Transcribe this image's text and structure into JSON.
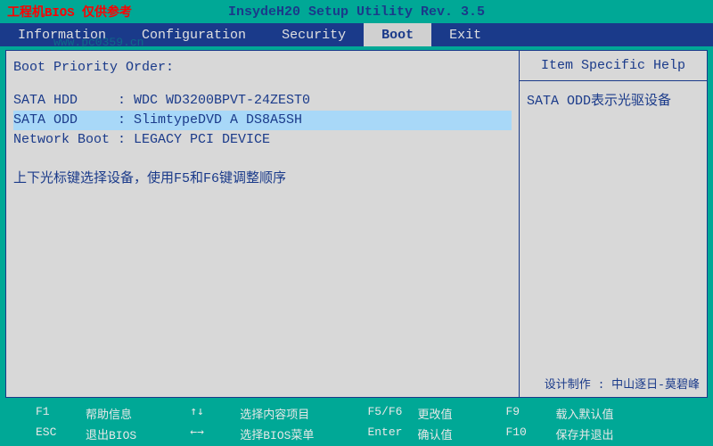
{
  "top": {
    "warning": "工程机BIOS  仅供参考",
    "title": "InsydeH20 Setup Utility Rev. 3.5"
  },
  "watermark": {
    "brand": "",
    "url": "www.pc0359.cn"
  },
  "tabs": {
    "items": [
      {
        "label": "Information"
      },
      {
        "label": "Configuration"
      },
      {
        "label": "Security"
      },
      {
        "label": "Boot"
      },
      {
        "label": "Exit"
      }
    ]
  },
  "main": {
    "header": "Boot Priority Order:",
    "rows": [
      {
        "key": "SATA HDD    ",
        "sep": " : ",
        "val": "WDC WD3200BPVT-24ZEST0",
        "selected": false
      },
      {
        "key": "SATA ODD    ",
        "sep": " : ",
        "val": "SlimtypeDVD A DS8A5SH",
        "selected": true
      },
      {
        "key": "Network Boot",
        "sep": " : ",
        "val": "LEGACY PCI DEVICE",
        "selected": false
      }
    ],
    "hint": "上下光标键选择设备，使用F5和F6键调整顺序"
  },
  "help": {
    "title": "Item Specific Help",
    "body": "SATA ODD表示光驱设备",
    "credit": "设计制作 : 中山逐日-莫碧峰"
  },
  "footer": {
    "c1": [
      {
        "k": "F1",
        "v": "帮助信息"
      },
      {
        "k": "ESC",
        "v": "退出BIOS"
      }
    ],
    "c2": [
      {
        "k": "↑↓",
        "v": "选择内容项目"
      },
      {
        "k": "←→",
        "v": "选择BIOS菜单"
      }
    ],
    "c3": [
      {
        "k": "F5/F6",
        "v": "更改值"
      },
      {
        "k": "Enter",
        "v": "确认值"
      }
    ],
    "c4": [
      {
        "k": "F9",
        "v": "载入默认值"
      },
      {
        "k": "F10",
        "v": "保存并退出"
      }
    ]
  }
}
